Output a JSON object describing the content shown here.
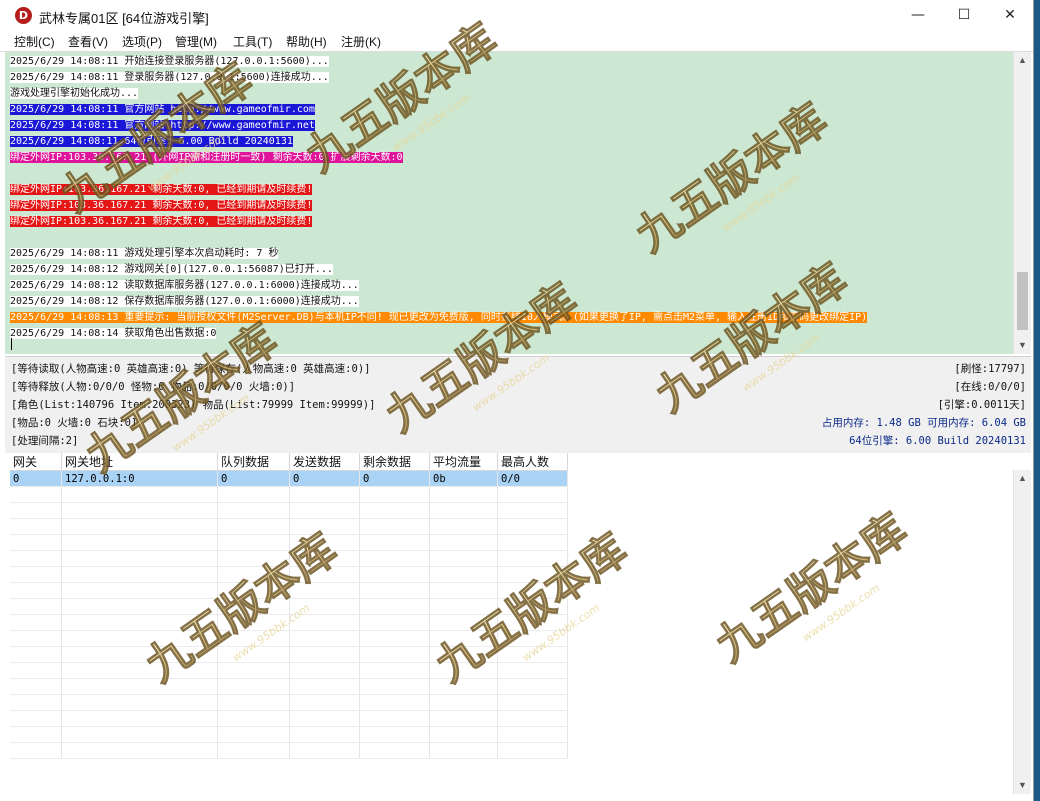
{
  "window": {
    "title": "武林专属01区 [64位游戏引擎]",
    "app_icon_letter": "D",
    "controls": {
      "minimize": "—",
      "maximize": "☐",
      "close": "✕"
    }
  },
  "menu": [
    "控制(C)",
    "查看(V)",
    "选项(P)",
    "管理(M)",
    "工具(T)",
    "帮助(H)",
    "注册(K)"
  ],
  "log": [
    {
      "text": "2025/6/29 14:08:11 开始连接登录服务器(127.0.0.1:5600)...",
      "style": "plain"
    },
    {
      "text": "2025/6/29 14:08:11 登录服务器(127.0.0.1:5600)连接成功...",
      "style": "plain"
    },
    {
      "text": "游戏处理引擎初始化成功...",
      "style": "plain"
    },
    {
      "text": "2025/6/29 14:08:11 官方网站 http://www.gameofmir.com",
      "style": "blue"
    },
    {
      "text": "2025/6/29 14:08:11 官方网站 http://www.gameofmir.net",
      "style": "blue"
    },
    {
      "text": "2025/6/29 14:08:11 64位引擎: 6.00 Build 20240131",
      "style": "blue"
    },
    {
      "text": "绑定外网IP:103.36.167.21 (外网IP需和注册时一致) 剩余天数:0 扩展剩余天数:0",
      "style": "magenta"
    },
    {
      "text": "",
      "style": "plain"
    },
    {
      "text": "绑定外网IP:103.36.167.21 剩余天数:0, 已经到期请及时续费!",
      "style": "red"
    },
    {
      "text": "绑定外网IP:103.36.167.21 剩余天数:0, 已经到期请及时续费!",
      "style": "red"
    },
    {
      "text": "绑定外网IP:103.36.167.21 剩余天数:0, 已经到期请及时续费!",
      "style": "red"
    },
    {
      "text": "",
      "style": "plain"
    },
    {
      "text": "2025/6/29 14:08:11 游戏处理引擎本次启动耗时: 7 秒",
      "style": "plain"
    },
    {
      "text": "2025/6/29 14:08:12 游戏网关[0](127.0.0.1:56087)已打开...",
      "style": "plain"
    },
    {
      "text": "2025/6/29 14:08:12 读取数据库服务器(127.0.0.1:6000)连接成功...",
      "style": "plain"
    },
    {
      "text": "2025/6/29 14:08:12 保存数据库服务器(127.0.0.1:6000)连接成功...",
      "style": "plain"
    },
    {
      "text": "2025/6/29 14:08:13 重要提示: 当前授权文件(M2Server.DB)与本机IP不同! 现已更改为免费版, 同时在线10人模式。(如果更换了IP, 需点击M2菜单, 输入注册ID和密码更改绑定IP)",
      "style": "orange"
    },
    {
      "text": "2025/6/29 14:08:14 获取角色出售数据:0",
      "style": "plain"
    }
  ],
  "status": {
    "read_wait": "[等待读取(人物高速:0 英雄高速:0) 等待保存(人物高速:0 英雄高速:0)]",
    "release_wait": "[等待释放(人物:0/0/0 怪物:0 物品:0/0/0/0 火墙:0)]",
    "role_items": "[角色(List:140796 Item:200323) 物品(List:79999 Item:99999)]",
    "items_line": "[物品:0 火墙:0 石块:0]",
    "interval": "[处理间隔:2]",
    "refresh": "[刷怪:17797]",
    "online": "[在线:0/0/0]",
    "engine": "[引擎:0.0011天]",
    "memory": "占用内存: 1.48 GB 可用内存: 6.04 GB",
    "version": "64位引擎: 6.00 Build 20240131"
  },
  "gateway_table": {
    "columns": [
      "网关",
      "网关地址",
      "队列数据",
      "发送数据",
      "剩余数据",
      "平均流量",
      "最高人数"
    ],
    "rows": [
      [
        "0",
        "127.0.0.1:0",
        "0",
        "0",
        "0",
        "0b",
        "0/0"
      ]
    ]
  },
  "watermark": {
    "logo_text": "九五版本库",
    "url_text": "www.95bbk.com"
  }
}
